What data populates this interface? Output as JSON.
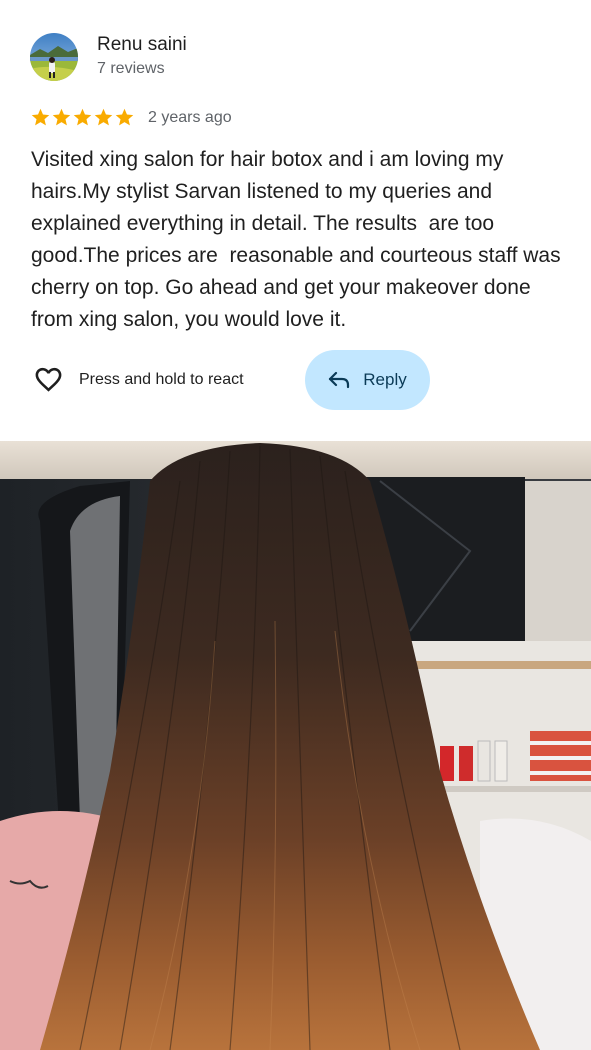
{
  "reviewer": {
    "name": "Renu saini",
    "reviews": "7 reviews",
    "avatar_icon": "avatar-landscape-photo"
  },
  "rating": {
    "stars": 5,
    "max_stars": 5,
    "time": "2 years ago",
    "star_color": "#f9ab00"
  },
  "review": {
    "text": "Visited xing salon for hair botox and i am loving my hairs.My stylist Sarvan listened to my queries and explained everything in detail. The results  are too good.The prices are  reasonable and courteous staff was cherry on top. Go ahead and get your makeover done from xing salon, you would love it."
  },
  "actions": {
    "react_label": "Press and hold to react",
    "react_icon": "heart-outline-icon",
    "reply_label": "Reply",
    "reply_icon": "reply-arrow-icon",
    "reply_bg": "#c2e7ff"
  },
  "photo": {
    "icon": "hair-photo"
  }
}
